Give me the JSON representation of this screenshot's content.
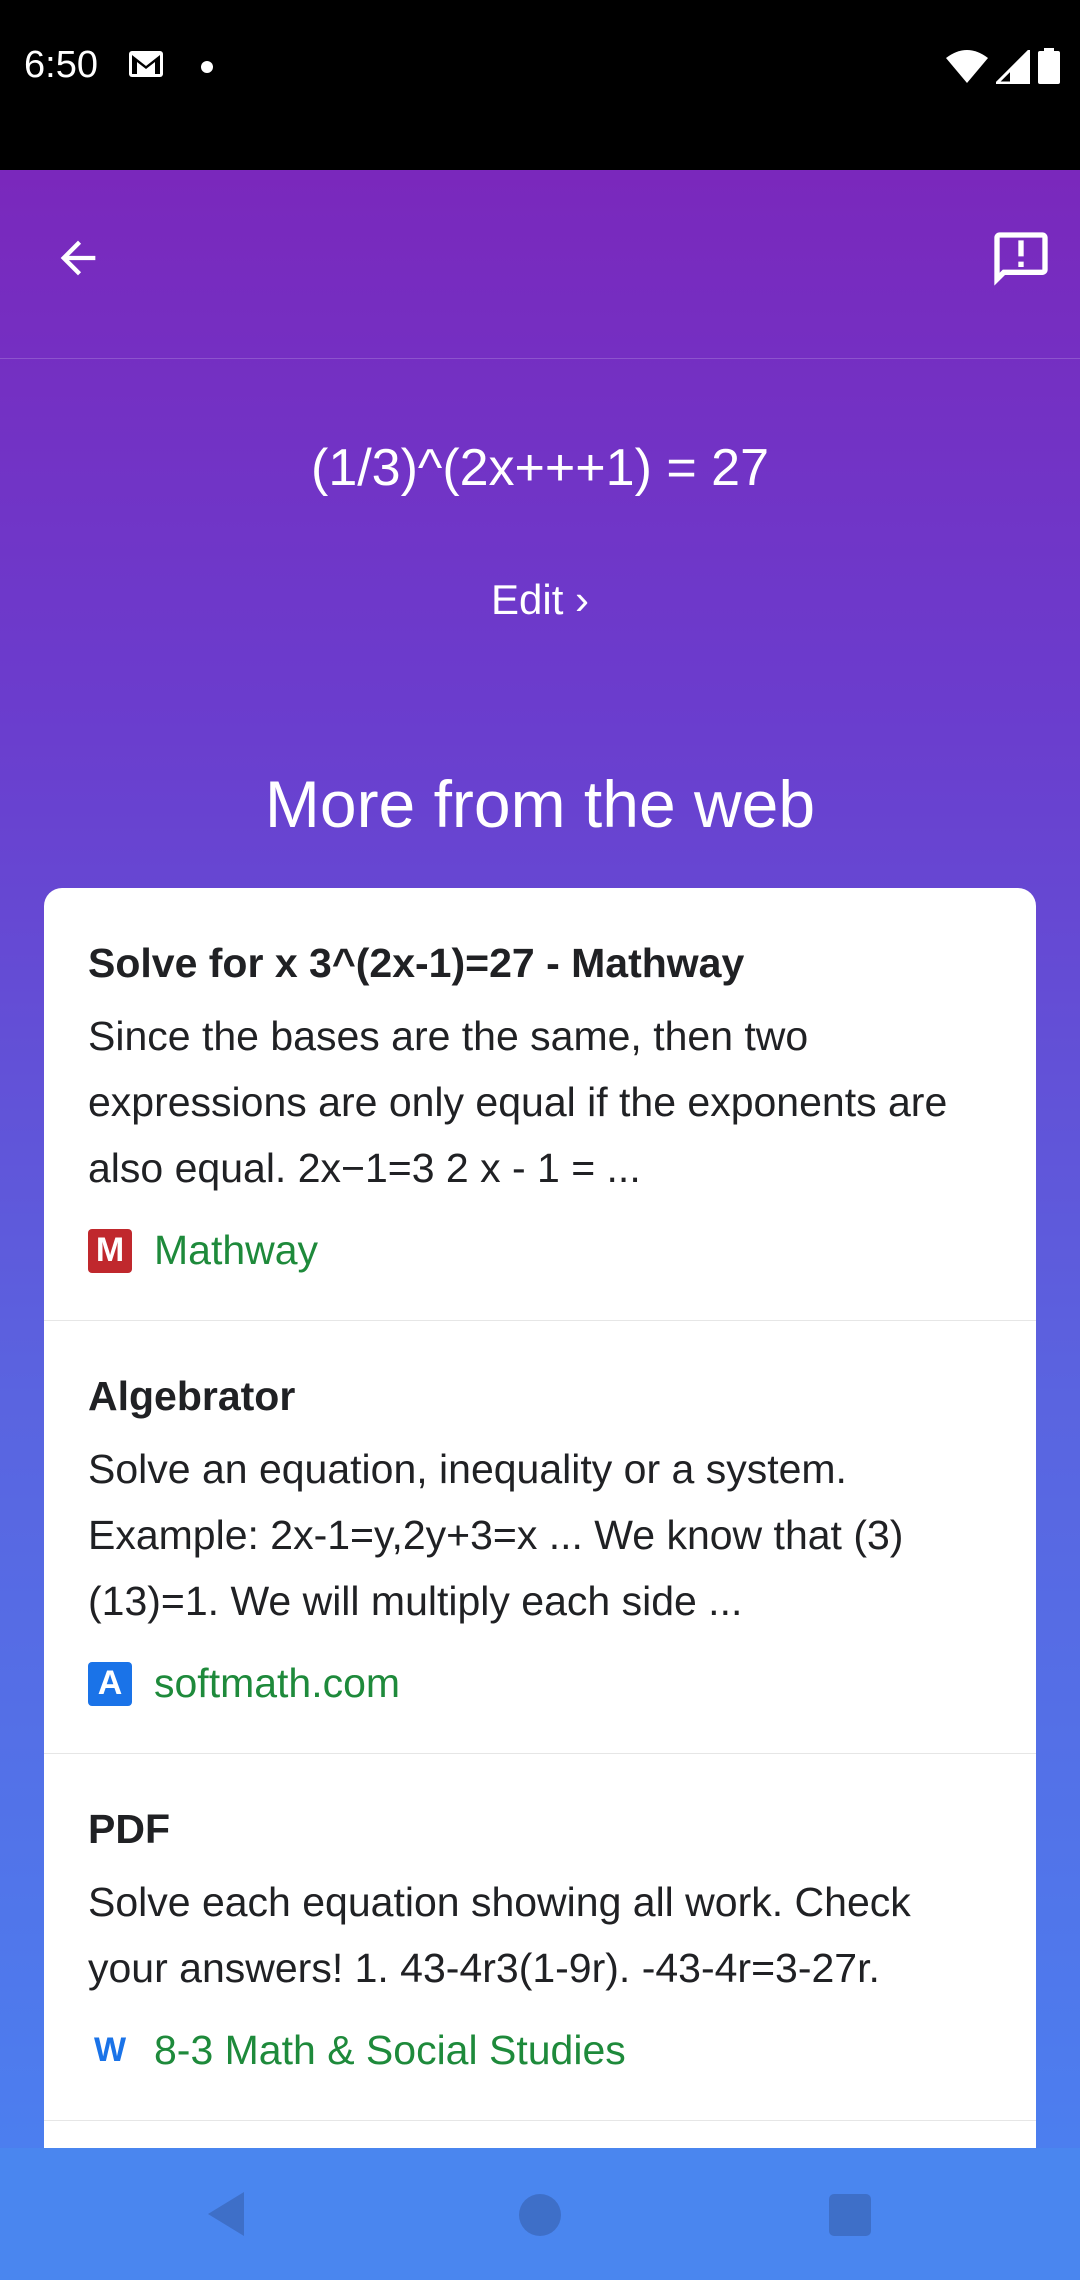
{
  "status_bar": {
    "time": "6:50"
  },
  "app_bar": {
    "back_icon": "arrow-back-icon",
    "feedback_icon": "feedback-icon"
  },
  "query": {
    "equation": "(1/3)^(2x+++1) = 27",
    "edit_label": "Edit ›"
  },
  "section_title": "More from the web",
  "results": [
    {
      "title": "Solve for x 3^(2x-1)=27 - Mathway",
      "snippet": "Since the bases are the same, then two expressions are only equal if the exponents are also equal. 2x−1=3 2 x - 1 = ...",
      "source": "Mathway",
      "source_icon": "M",
      "icon_color": "#c0282d"
    },
    {
      "title": "Algebrator",
      "snippet": "Solve an equation, inequality or a system. Example: 2x-1=y,2y+3=x ... We know that (3)(13)=1. We will multiply each side ...",
      "source": "softmath.com",
      "source_icon": "A",
      "icon_color": "#1a73e8"
    },
    {
      "title": "PDF",
      "snippet": "Solve each equation showing all work. Check your answers! 1. 43-4r3(1-9r). -43-4r=3-27r.",
      "source": "8-3 Math & Social Studies",
      "source_icon": "W",
      "icon_color": "#1a73e8"
    }
  ]
}
